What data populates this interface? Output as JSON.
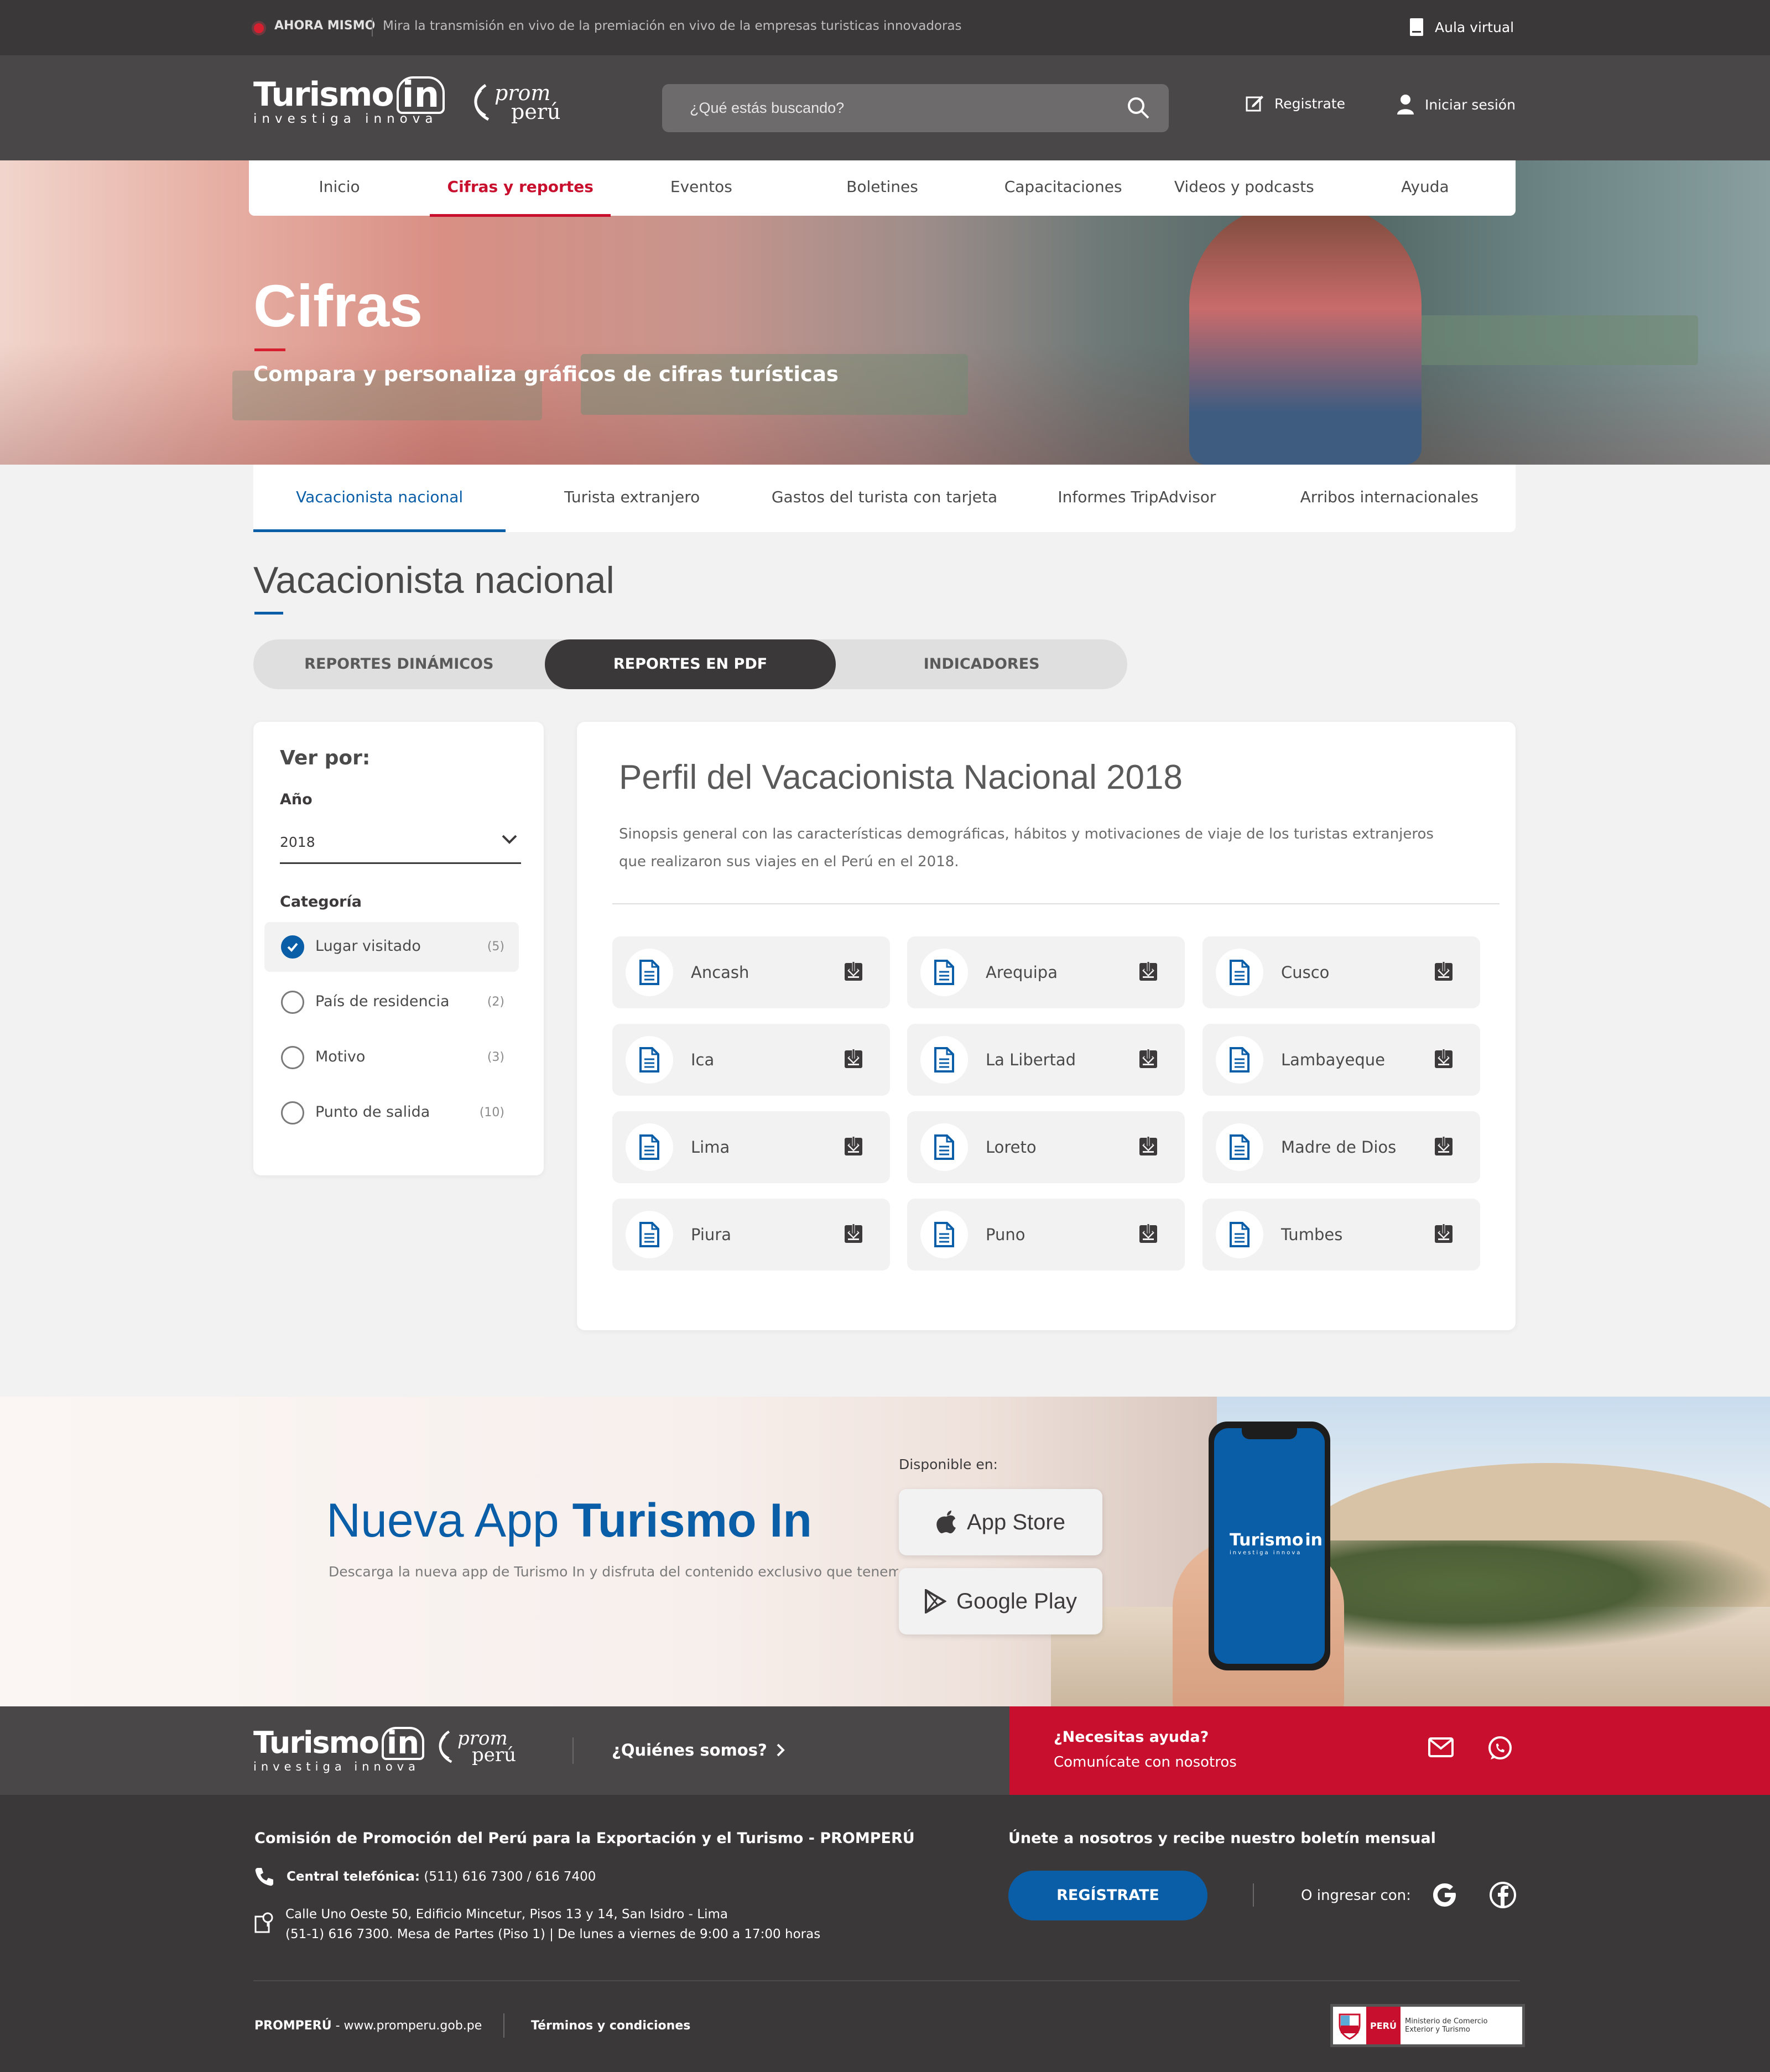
{
  "topbar": {
    "live_label": "AHORA MISMO",
    "live_text": "Mira la transmisión en vivo de la premiación en vivo de la empresas turisticas innovadoras",
    "aula_label": "Aula virtual"
  },
  "header": {
    "logo_word": "Turismo",
    "logo_in": "in",
    "logo_tagline": "investiga innova",
    "partner_logo_top": "prom",
    "partner_logo_bottom": "perú",
    "search_placeholder": "¿Qué estás buscando?",
    "register_label": "Registrate",
    "login_label": "Iniciar sesión"
  },
  "nav": {
    "items": [
      {
        "label": "Inicio",
        "active": false
      },
      {
        "label": "Cifras y reportes",
        "active": true
      },
      {
        "label": "Eventos",
        "active": false
      },
      {
        "label": "Boletines",
        "active": false
      },
      {
        "label": "Capacitaciones",
        "active": false
      },
      {
        "label": "Videos y podcasts",
        "active": false
      },
      {
        "label": "Ayuda",
        "active": false
      }
    ]
  },
  "hero": {
    "title": "Cifras",
    "subtitle": "Compara y personaliza gráficos  de cifras turísticas"
  },
  "subtabs": [
    {
      "label": "Vacacionista nacional",
      "active": true
    },
    {
      "label": "Turista extranjero",
      "active": false
    },
    {
      "label": "Gastos del turista con tarjeta",
      "active": false
    },
    {
      "label": "Informes TripAdvisor",
      "active": false
    },
    {
      "label": "Arribos internacionales",
      "active": false
    }
  ],
  "section": {
    "title": "Vacacionista nacional",
    "segments": [
      {
        "label": "REPORTES DINÁMICOS",
        "active": false
      },
      {
        "label": "REPORTES EN PDF",
        "active": true
      },
      {
        "label": "INDICADORES",
        "active": false
      }
    ]
  },
  "filter": {
    "title": "Ver por:",
    "year_label": "Año",
    "year_value": "2018",
    "category_label": "Categoría",
    "categories": [
      {
        "name": "Lugar visitado",
        "count": "(5)",
        "checked": true
      },
      {
        "name": "País de residencia",
        "count": "(2)",
        "checked": false
      },
      {
        "name": "Motivo",
        "count": "(3)",
        "checked": false
      },
      {
        "name": "Punto de salida",
        "count": "(10)",
        "checked": false
      }
    ]
  },
  "report": {
    "title": "Perfil del Vacacionista Nacional 2018",
    "description": "Sinopsis general con las características demográficas, hábitos y motivaciones de viaje de los turistas extranjeros que realizaron sus viajes en el Perú en el 2018.",
    "files": [
      "Ancash",
      "Arequipa",
      "Cusco",
      "Ica",
      "La Libertad",
      "Lambayeque",
      "Lima",
      "Loreto",
      "Madre de Dios",
      "Piura",
      "Puno",
      "Tumbes"
    ]
  },
  "app_banner": {
    "title_normal": "Nueva App ",
    "title_bold": "Turismo In",
    "description": "Descarga la nueva app de Turismo In y disfruta del contenido exclusivo que tenemos para ti",
    "available_label": "Disponible en:",
    "app_store_label": "App Store",
    "google_play_label": "Google Play"
  },
  "footer": {
    "about_label": "¿Quiénes somos?",
    "help_title": "¿Necesitas ayuda?",
    "help_sub": "Comunícate con nosotros",
    "org_name": "Comisión de Promoción del Perú para la Exportación y el Turismo - PROMPERÚ",
    "phone_label": "Central telefónica:",
    "phone_value": "(511) 616 7300 / 616 7400",
    "address_line1": "Calle Uno Oeste 50, Edificio Mincetur, Pisos 13 y 14, San Isidro - Lima",
    "address_line2": "(51-1) 616 7300. Mesa de Partes (Piso 1) | De lunes a viernes de 9:00 a 17:00 horas",
    "newsletter_title": "Únete a nosotros y recibe nuestro boletín mensual",
    "register_button": "REGÍSTRATE",
    "login_with": "O ingresar con:",
    "site_org": "PROMPERÚ",
    "site_url": " - www.promperu.gob.pe",
    "terms": "Términos y condiciones",
    "ministry_country": "PERÚ",
    "ministry_name": "Ministerio de Comercio Exterior y Turismo"
  },
  "colors": {
    "brand_red": "#c8102e",
    "brand_blue": "#0a5ea8",
    "dark_gray": "#3a3839"
  }
}
